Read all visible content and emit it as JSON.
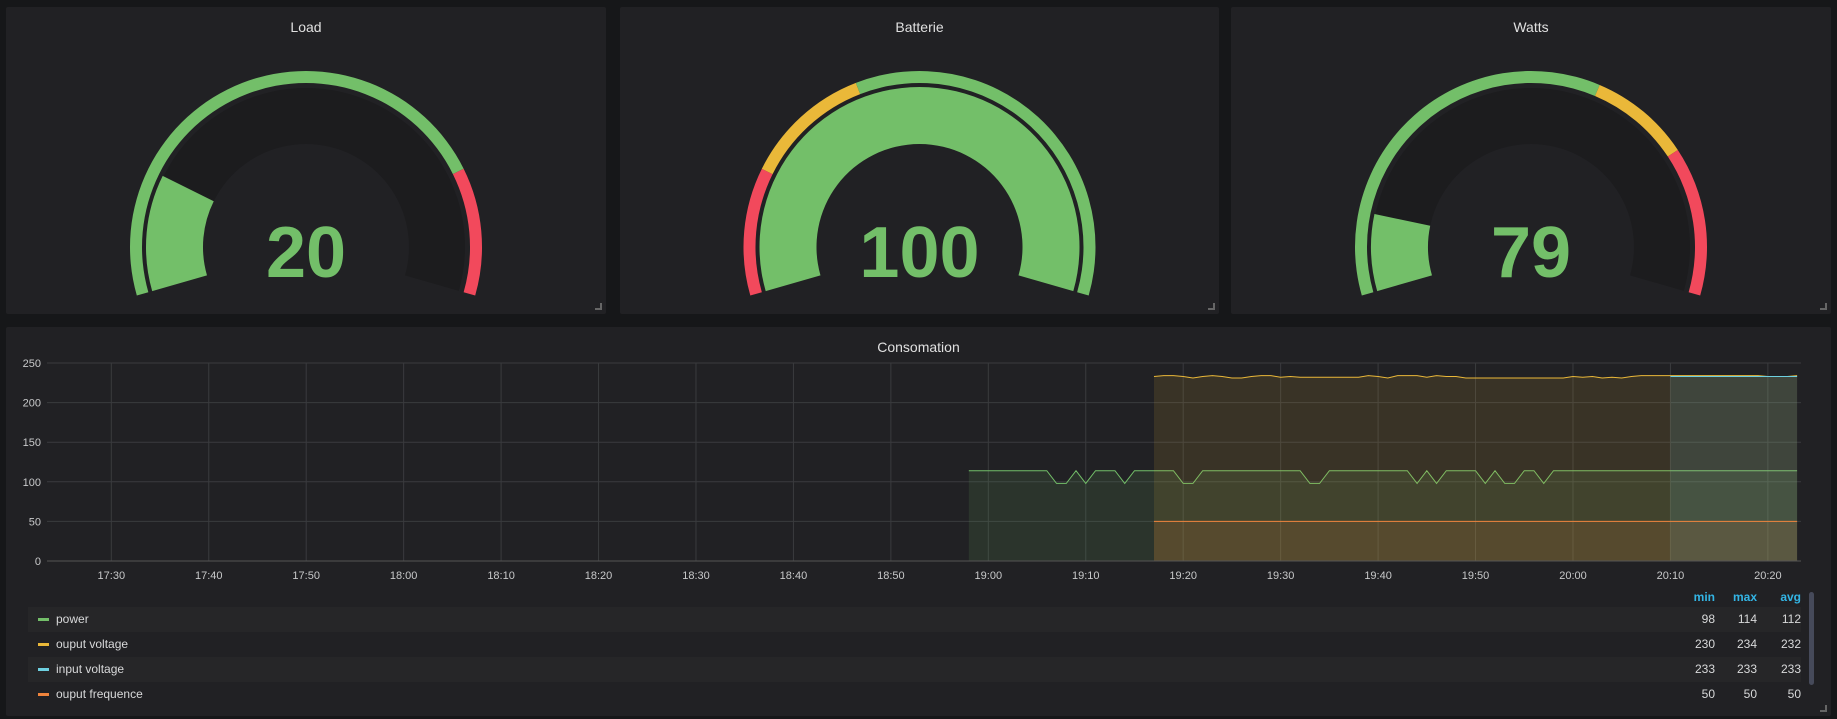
{
  "gauges": [
    {
      "title": "Load",
      "value": "20",
      "num": 20,
      "min": 0,
      "max": 100,
      "thresholds": [
        {
          "from": 0,
          "color": "#73bf69"
        },
        {
          "from": 80,
          "color": "#f2495c"
        }
      ]
    },
    {
      "title": "Batterie",
      "value": "100",
      "num": 100,
      "min": 0,
      "max": 100,
      "thresholds": [
        {
          "from": 0,
          "color": "#f2495c"
        },
        {
          "from": 20,
          "color": "#eab839"
        },
        {
          "from": 40,
          "color": "#73bf69"
        }
      ]
    },
    {
      "title": "Watts",
      "value": "79",
      "num": 79,
      "min": 0,
      "max": 600,
      "thresholds": [
        {
          "from": 0,
          "color": "#73bf69"
        },
        {
          "from": 365,
          "color": "#eab839"
        },
        {
          "from": 460,
          "color": "#f2495c"
        }
      ]
    }
  ],
  "graph": {
    "title": "Consomation",
    "chart_data": {
      "type": "line",
      "x_range": [
        "17:23:24",
        "20:23:24"
      ],
      "ylim": [
        0,
        250
      ],
      "y_ticks": [
        "0",
        "50",
        "100",
        "150",
        "200",
        "250"
      ],
      "x_ticks": [
        "17:30",
        "17:40",
        "17:50",
        "18:00",
        "18:10",
        "18:20",
        "18:30",
        "18:40",
        "18:50",
        "19:00",
        "19:10",
        "19:20",
        "19:30",
        "19:40",
        "19:50",
        "20:00",
        "20:10",
        "20:20"
      ],
      "series": [
        {
          "name": "power",
          "color": "#73bf69",
          "start": "18:58",
          "end": "20:23",
          "base": 114,
          "dip": 98,
          "dip_minutes": [
            "19:07",
            "19:08",
            "19:10",
            "19:14",
            "19:20",
            "19:21",
            "19:33",
            "19:34",
            "19:44",
            "19:46",
            "19:51",
            "19:53",
            "19:54",
            "19:57"
          ]
        },
        {
          "name": "ouput voltage",
          "color": "#eab839",
          "start": "19:17",
          "step_min": 1,
          "values": [
            233,
            234,
            234,
            233,
            231,
            233,
            234,
            233,
            231,
            231,
            233,
            234,
            234,
            232,
            233,
            232,
            232,
            232,
            232,
            232,
            232,
            232,
            234,
            233,
            231,
            234,
            234,
            234,
            232,
            234,
            233,
            233,
            231,
            231,
            231,
            231,
            231,
            231,
            231,
            231,
            231,
            231,
            231,
            233,
            232,
            233,
            231,
            232,
            231,
            233,
            234,
            234,
            234,
            234,
            234,
            234,
            234,
            234,
            234,
            234,
            234,
            234,
            234,
            233,
            233,
            233,
            234
          ]
        },
        {
          "name": "input voltage",
          "color": "#6ed0e0",
          "start": "20:10",
          "step_min": 1,
          "values": [
            233,
            233,
            233,
            233,
            233,
            233,
            233,
            233,
            233,
            233,
            233,
            233,
            233,
            233
          ]
        },
        {
          "name": "ouput frequence",
          "color": "#ef843c",
          "start": "19:17",
          "step_min": 1,
          "constant": 50,
          "end": "20:23"
        }
      ]
    },
    "legend": {
      "headers": [
        "min",
        "max",
        "avg"
      ],
      "rows": [
        {
          "name": "power",
          "color": "#73bf69",
          "min": "98",
          "max": "114",
          "avg": "112"
        },
        {
          "name": "ouput voltage",
          "color": "#eab839",
          "min": "230",
          "max": "234",
          "avg": "232"
        },
        {
          "name": "input voltage",
          "color": "#6ed0e0",
          "min": "233",
          "max": "233",
          "avg": "233"
        },
        {
          "name": "ouput frequence",
          "color": "#ef843c",
          "min": "50",
          "max": "50",
          "avg": "50"
        }
      ]
    }
  }
}
